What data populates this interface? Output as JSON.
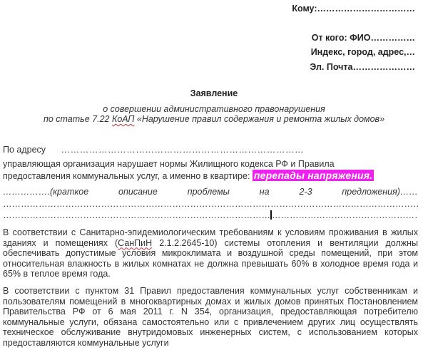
{
  "header": {
    "to": "Кому:……………………………",
    "from": "От кого: ФИО……………",
    "address": "Индекс, город, адрес,…",
    "email": "Эл. Почта…………………"
  },
  "title": "Заявление",
  "subtitle": {
    "line1": "о совершении административного правонарушения",
    "line2_pre": "по статье 7.22 ",
    "line2_koap": "КоАП",
    "line2_post": " «Нарушение правил содержания и ремонта жилых домов»"
  },
  "body": {
    "address_label": "По адресу",
    "address_dots": "……………………………………………………………………",
    "intro_line1": "управляющая организация нарушает нормы Жилищного кодекса РФ и Правила",
    "intro_line2": "предоставления коммунальных услуг, а именно в квартире:",
    "highlight": "перепады напряжения.",
    "desc_words": [
      "…………….(краткое",
      "описание",
      "проблемы",
      "на",
      "2-3",
      "предложения)……"
    ],
    "dots_line": "……………………………………………………………………………………………………………………………………………",
    "dots_line2a": "………………………………………………………………………………",
    "dots_line2b": "……………………………………………………………………………",
    "para1_pre": "В соответствии с Санитарно-эпидемиологическим требованиям к условиям проживания в жилых зданиях и помещениях (",
    "para1_sanpin": "СанПиН",
    "para1_post": " 2.1.2.2645-10) системы отопления и вентиляции должны обеспечивать допустимые условия микроклимата и воздушной среды помещений, при этом относительная влажность в жилых комнатах не должна превышать 60% в холодное время года и 65% в теплое время года.",
    "para2": "В соответствии с пунктом 31 Правил предоставления коммунальных услуг собственникам и пользователям помещений в многоквартирных домах и жилых домов принятых Постановлением Правительства РФ от 6 мая 2011 г. N 354, организация, предоставляющая потребителю коммунальные услуги, обязана самостоятельно или с привлечением других лиц осуществлять техническое обслуживание внутридомовых инженерных систем, с использованием которых предоставляются коммунальные услуги"
  }
}
